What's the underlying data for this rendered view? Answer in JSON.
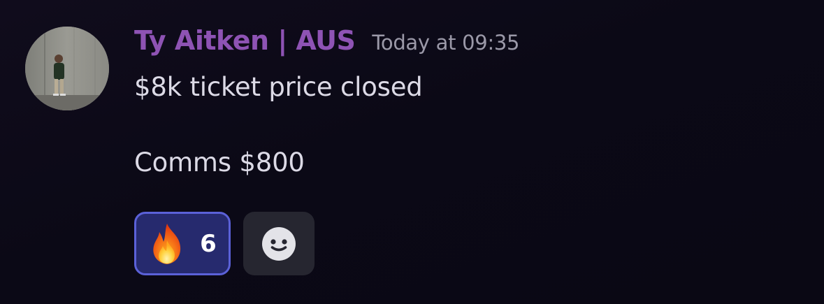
{
  "message": {
    "author": {
      "name": "Ty Aitken | AUS",
      "name_color": "#8e53b4",
      "avatar": "avatar-photo"
    },
    "timestamp": "Today at 09:35",
    "content": {
      "line1": "$8k ticket price closed",
      "line2": "Comms $800"
    },
    "reactions": [
      {
        "emoji": "fire-emoji",
        "count": "6",
        "active": true
      }
    ],
    "add_reaction_icon": "smiley-face-icon"
  }
}
